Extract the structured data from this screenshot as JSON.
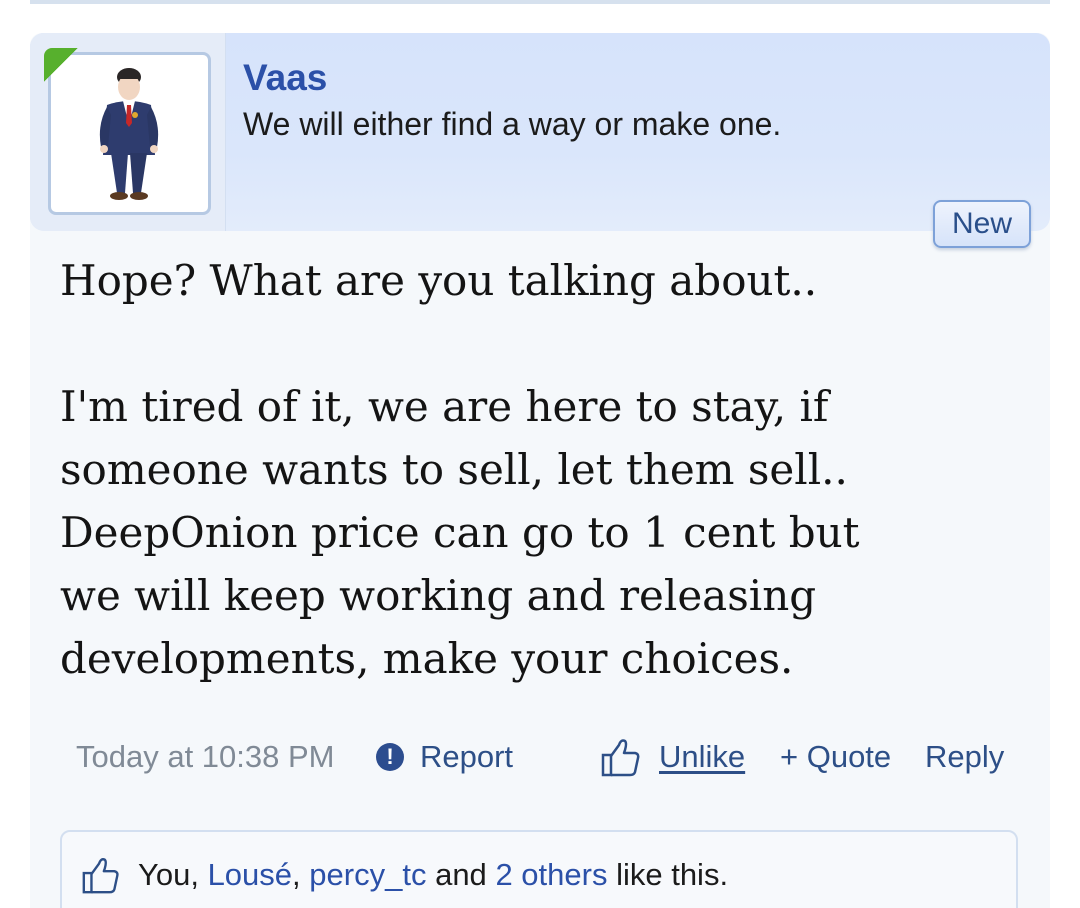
{
  "post": {
    "author": {
      "name": "Vaas",
      "title": "We will either find a way or make one.",
      "avatar_icon": "businessman-avatar-icon"
    },
    "badge": "New",
    "message_paragraphs": [
      "Hope? What are you talking about..",
      "I'm tired of it, we are here to stay, if\nsomeone wants to sell, let them sell..\nDeepOnion price can go to 1 cent but\nwe will keep working and releasing\ndevelopments, make your choices."
    ],
    "footer": {
      "timestamp": "Today at 10:38 PM",
      "report_label": "Report",
      "report_icon": "exclamation-circle-icon",
      "unlike_label": "Unlike",
      "like_icon": "thumbs-up-icon",
      "quote_label": "+ Quote",
      "reply_label": "Reply"
    },
    "likes": {
      "you": "You,",
      "sep1": ",",
      "user1": "Lousé",
      "user2": "percy_tc",
      "and": "and",
      "others": "2 others",
      "suffix": "like this."
    }
  },
  "colors": {
    "accent": "#2b50a8",
    "header_bg": "#d6e3fb",
    "post_bg": "#f5f8fb",
    "online_indicator": "#57b02d"
  }
}
